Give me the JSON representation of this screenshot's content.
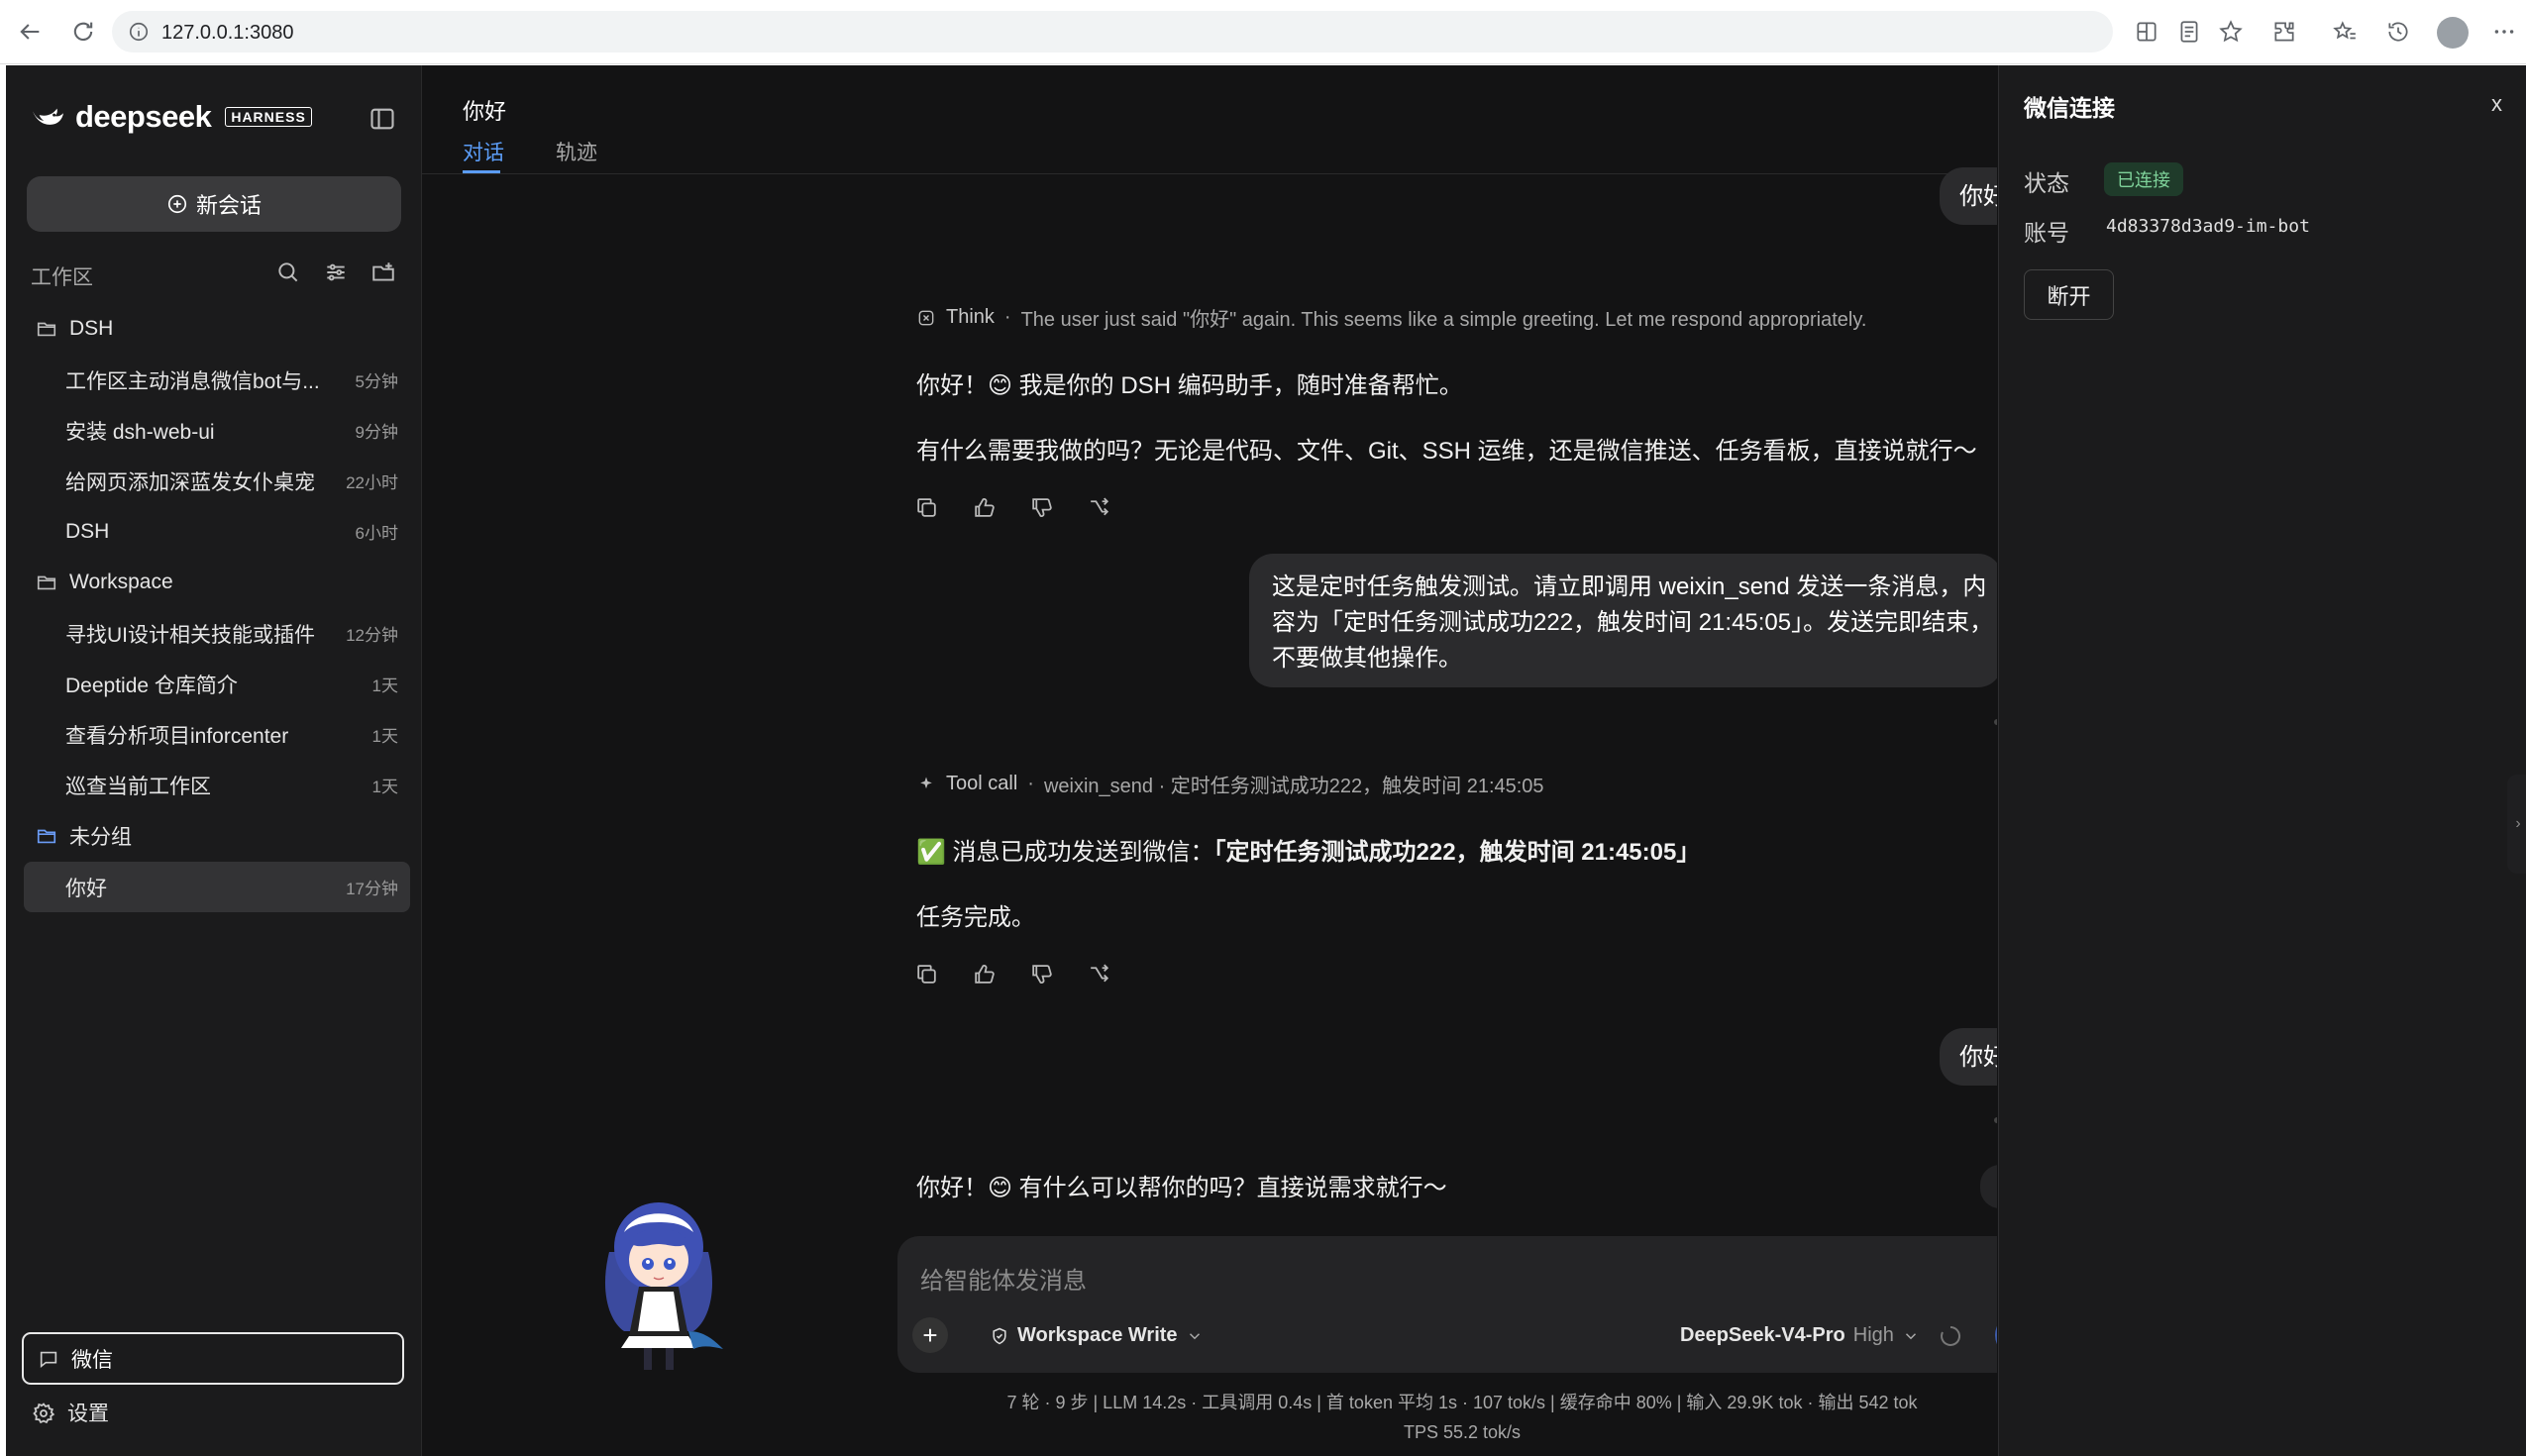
{
  "browser": {
    "url": "127.0.0.1:3080",
    "icons": [
      "back-icon",
      "reload-icon",
      "site-info-icon",
      "split-view-icon",
      "reading-mode-icon",
      "favorite-star-icon",
      "extensions-icon",
      "favorites-icon",
      "history-icon",
      "profile-avatar",
      "more-icon"
    ]
  },
  "sidebar": {
    "brand": "deepseek",
    "brand_tag": "HARNESS",
    "new_chat": "新会话",
    "workspace_label": "工作区",
    "groups": [
      {
        "name": "DSH",
        "items": [
          {
            "title": "工作区主动消息微信bot与...",
            "ago": "5分钟"
          },
          {
            "title": "安装 dsh-web-ui",
            "ago": "9分钟"
          },
          {
            "title": "给网页添加深蓝发女仆桌宠",
            "ago": "22小时"
          },
          {
            "title": "DSH",
            "ago": "6小时"
          }
        ]
      },
      {
        "name": "Workspace",
        "items": [
          {
            "title": "寻找UI设计相关技能或插件",
            "ago": "12分钟"
          },
          {
            "title": "Deeptide 仓库简介",
            "ago": "1天"
          },
          {
            "title": "查看分析项目inforcenter",
            "ago": "1天"
          },
          {
            "title": "巡查当前工作区",
            "ago": "1天"
          }
        ]
      },
      {
        "name": "未分组",
        "items": [
          {
            "title": "你好",
            "ago": "17分钟"
          }
        ]
      }
    ],
    "wechat": "微信",
    "settings": "设置"
  },
  "chat": {
    "title": "你好",
    "tabs": [
      "对话",
      "轨迹"
    ],
    "user_top": "你好",
    "think_label": "Think",
    "think_text": "The user just said \"你好\" again. This seems like a simple greeting. Let me respond appropriately.",
    "reply1_line1": "你好！😊 我是你的 DSH 编码助手，随时准备帮忙。",
    "reply1_line2": "有什么需要我做的吗？无论是代码、文件、Git、SSH 运维，还是微信推送、任务看板，直接说就行～",
    "user_msg_line1": "这是定时任务触发测试。请立即调用 weixin_send 发送一条消息，内",
    "user_msg_line2": "容为「定时任务测试成功222，触发时间 21:45:05」。发送完即结束，",
    "user_msg_line3": "不要做其他操作。",
    "tool_label": "Tool call",
    "tool_text": "weixin_send · 定时任务测试成功222，触发时间 21:45:05",
    "sent_prefix": "✅ 消息已成功发送到微信：",
    "sent_bold": "「定时任务测试成功222，触发时间 21:45:05」",
    "done": "任务完成。",
    "user_hello2": "你好",
    "reply3": "你好！😊 有什么可以帮你的吗？直接说需求就行～",
    "input_placeholder": "给智能体发消息",
    "mode": "Workspace Write",
    "model": "DeepSeek-V4-Pro",
    "effort": "High",
    "stats_line1": "7 轮 · 9 步  |  LLM 14.2s · 工具调用 0.4s  |  首 token 平均 1s · 107 tok/s  |  缓存命中 80%  |  输入 29.9K tok · 输出 542 tok",
    "stats_line2": "TPS 55.2 tok/s"
  },
  "panel": {
    "title": "微信连接",
    "close": "x",
    "status_label": "状态",
    "status_value": "已连接",
    "account_label": "账号",
    "account_value": "4d83378d3ad9-im-bot",
    "disconnect": "断开"
  },
  "colors": {
    "accent": "#5b9cf6",
    "connected": "#7fd29a",
    "background": "#131314",
    "sidebar": "#1b1b1c"
  }
}
